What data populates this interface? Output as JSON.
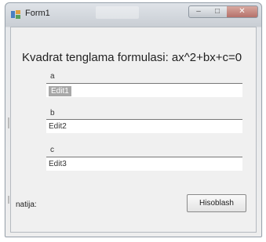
{
  "window": {
    "title": "Form1",
    "min_glyph": "–",
    "max_glyph": "□",
    "close_glyph": "✕"
  },
  "form": {
    "formula_label": "Kvadrat tenglama  formulasi: ax^2+bx+c=0",
    "fields": [
      {
        "label": "a",
        "value": "Edit1",
        "selected": true
      },
      {
        "label": "b",
        "value": "Edit2"
      },
      {
        "label": "c",
        "value": "Edit3"
      }
    ],
    "result_label": "natija:",
    "calc_button": "Hisoblash"
  }
}
